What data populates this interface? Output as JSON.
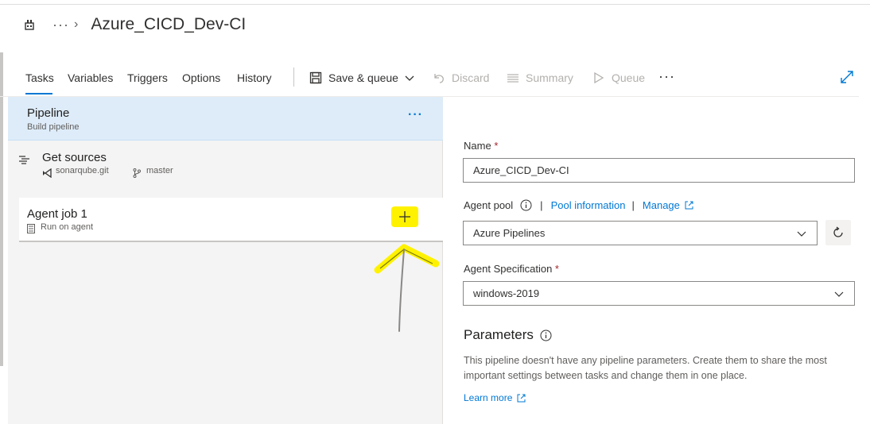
{
  "header": {
    "title": "Azure_CICD_Dev-CI",
    "breadcrumb_more": "···",
    "breadcrumb_separator": "›",
    "app_icon": "build-pipeline-icon"
  },
  "toolbar": {
    "tabs": [
      {
        "label": "Tasks",
        "active": true
      },
      {
        "label": "Variables",
        "active": false
      },
      {
        "label": "Triggers",
        "active": false
      },
      {
        "label": "Options",
        "active": false
      },
      {
        "label": "History",
        "active": false
      }
    ],
    "save_queue": "Save & queue",
    "discard": "Discard",
    "summary": "Summary",
    "queue": "Queue",
    "more": "···"
  },
  "pipeline": {
    "title": "Pipeline",
    "subtitle": "Build pipeline",
    "more": "···"
  },
  "sources": {
    "title": "Get sources",
    "repo": "sonarqube.git",
    "branch": "master"
  },
  "agent_job": {
    "title": "Agent job 1",
    "subtitle": "Run on agent",
    "add_label": "+"
  },
  "form": {
    "name_label": "Name",
    "name_value": "Azure_CICD_Dev-CI",
    "required_mark": "*",
    "agent_pool_label": "Agent pool",
    "pool_info_link": "Pool information",
    "manage_link": "Manage",
    "link_separator": "|",
    "agent_pool_value": "Azure Pipelines",
    "agent_spec_label": "Agent Specification",
    "agent_spec_value": "windows-2019"
  },
  "parameters": {
    "heading": "Parameters",
    "description": "This pipeline doesn't have any pipeline parameters. Create them to share the most important settings between tasks and change them in one place.",
    "learn_more": "Learn more"
  },
  "colors": {
    "accent": "#0078d4",
    "selected_row": "#deecf9",
    "highlight": "#fff200",
    "required": "#a4262c"
  }
}
